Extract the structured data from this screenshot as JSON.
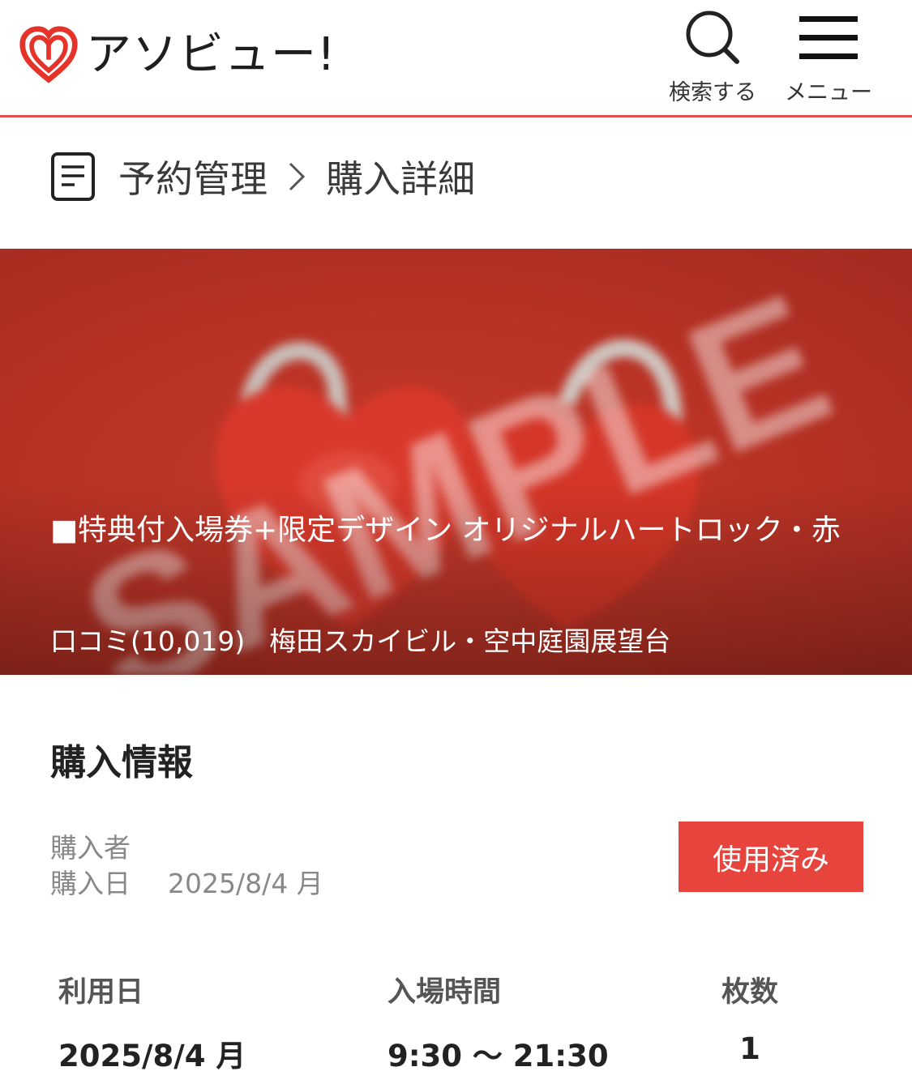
{
  "header": {
    "logo_text": "アソビュー!",
    "search_label": "検索する",
    "menu_label": "メニュー"
  },
  "breadcrumb": {
    "parent": "予約管理",
    "current": "購入詳細"
  },
  "hero": {
    "watermark": "SAMPLE",
    "title": "■特典付入場券+限定デザイン オリジナルハートロック・赤",
    "reviews": "口コミ(10,019)",
    "venue": "梅田スカイビル・空中庭園展望台"
  },
  "purchase": {
    "section_title": "購入情報",
    "buyer_label": "購入者",
    "date_label": "購入日",
    "date_value": "2025/8/4 月",
    "status": "使用済み",
    "use_date_label": "利用日",
    "use_date_value": "2025/8/4 月",
    "entry_time_label": "入場時間",
    "entry_time_value": "9:30 〜 21:30",
    "count_label": "枚数",
    "count_value": "1"
  },
  "colors": {
    "accent": "#e8443e",
    "header_border": "#e3524f",
    "hero_bg": "#b83225"
  },
  "icons": [
    "heart-logo-icon",
    "search-icon",
    "hamburger-menu-icon",
    "document-icon",
    "chevron-right-icon"
  ]
}
